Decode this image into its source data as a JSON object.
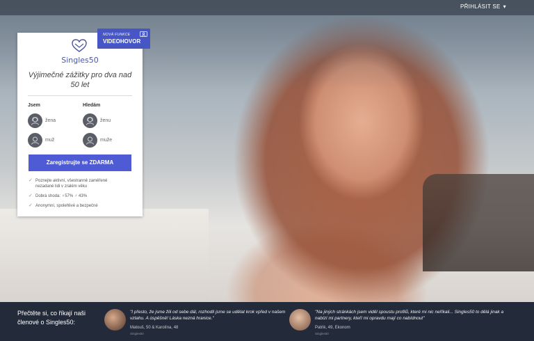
{
  "header": {
    "login_label": "PŘIHLÁSIT SE",
    "login_chevron": "▾"
  },
  "ribbon": {
    "small": "NOVÁ FUNKCE",
    "big": "VIDEOHOVOR",
    "icon": "video-icon"
  },
  "card": {
    "brand": "Singles50",
    "tagline": "Výjimečné zážitky pro dva nad 50 let",
    "col_left_head": "Jsem",
    "col_right_head": "Hledám",
    "left_options": [
      "žena",
      "muž"
    ],
    "right_options": [
      "ženu",
      "muže"
    ],
    "cta_label": "Zaregistrujte se ZDARMA",
    "bullets": [
      "Poznejte aktivní, všestranně zaměřené nezadané lidi v zralém věku",
      "Dobrá shoda: ♀57% ♂ 43%",
      "Anonymní, spolehlivé a bezpečné"
    ],
    "accent": "#4f5bd5"
  },
  "testimonials": {
    "intro": "Přečtěte si, co říkají naši členové o Singles50:",
    "items": [
      {
        "quote": "\"I přesto, že jsme žili od sebe dál, rozhodli jsme se udělat krok vpřed v našem vztahu. A úspěšně! Láska nezná hranice.\"",
        "name": "Matouš, 50 & Karolína, 48",
        "source": "Singles50"
      },
      {
        "quote": "\"Na jiných stránkách jsem viděl spoustu profilů, které mi nic neříkali... Singles50 to dělá jinak a nabízí mi partnery, kteří mi opravdu mají co nabídnout\"",
        "name": "Patrik, 49, Ekonom",
        "source": "Singles50"
      }
    ]
  }
}
